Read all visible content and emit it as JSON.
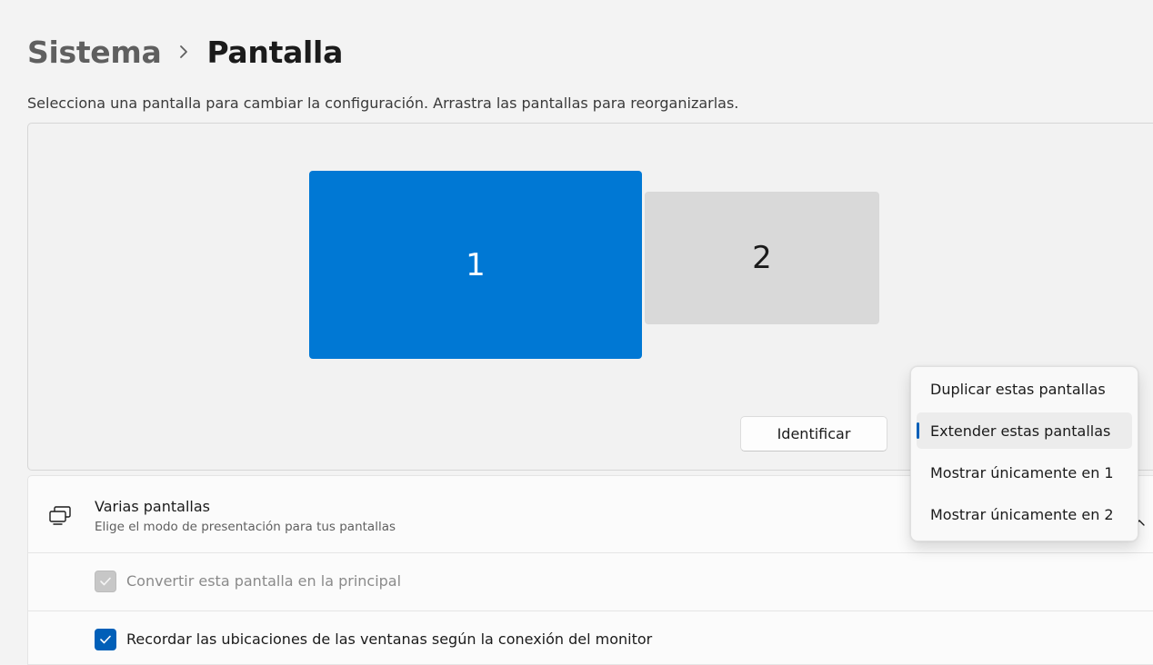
{
  "breadcrumb": {
    "parent": "Sistema",
    "current": "Pantalla"
  },
  "instructions": "Selecciona una pantalla para cambiar la configuración. Arrastra las pantallas para reorganizarlas.",
  "monitors": [
    {
      "label": "1",
      "selected": true,
      "color": "#0078d4"
    },
    {
      "label": "2",
      "selected": false,
      "color": "#d9d9d9"
    }
  ],
  "identify_button": "Identificar",
  "multiple_displays": {
    "title": "Varias pantallas",
    "subtitle": "Elige el modo de presentación para tus pantallas",
    "icon": "multiple-displays-icon"
  },
  "dropdown": {
    "options": [
      "Duplicar estas pantallas",
      "Extender estas pantallas",
      "Mostrar únicamente en 1",
      "Mostrar únicamente en 2"
    ],
    "selected_index": 1,
    "accent": "#005fb8"
  },
  "checkboxes": {
    "make_primary": {
      "label": "Convertir esta pantalla en la principal",
      "checked": true,
      "disabled": true
    },
    "remember_locations": {
      "label": "Recordar las ubicaciones de las ventanas según la conexión del monitor",
      "checked": true,
      "disabled": false
    }
  }
}
